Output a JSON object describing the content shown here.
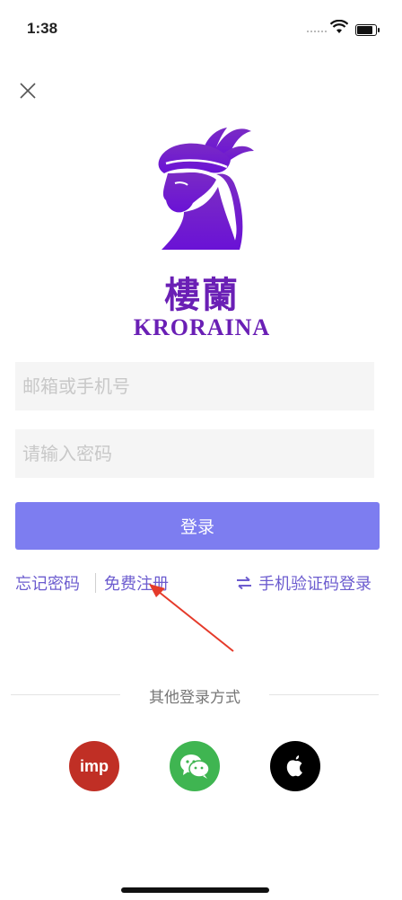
{
  "status_bar": {
    "time": "1:38"
  },
  "logo": {
    "chinese": "樓蘭",
    "english": "KRORAINA"
  },
  "form": {
    "email_placeholder": "邮箱或手机号",
    "password_placeholder": "请输入密码",
    "login_label": "登录"
  },
  "links": {
    "forgot": "忘记密码",
    "register": "免费注册",
    "sms_login": "手机验证码登录"
  },
  "other_login": {
    "title": "其他登录方式",
    "imp_label": "imp"
  },
  "colors": {
    "primary": "#7d7df0",
    "link": "#6c5ccf",
    "brand_purple": "#6a1fb5",
    "imp_red": "#c02f25",
    "wechat_green": "#3fb551",
    "annotation_red": "#e53a2a"
  }
}
